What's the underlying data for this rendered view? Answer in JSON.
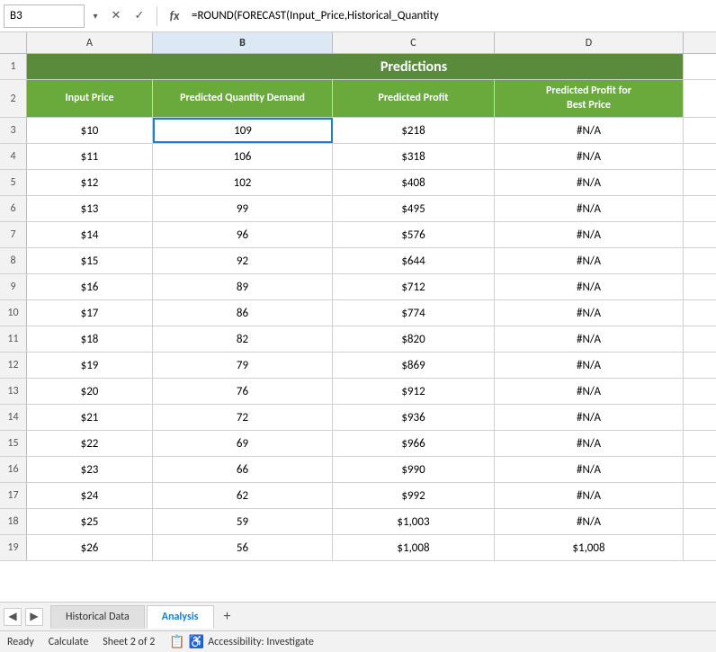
{
  "formula_bar": {
    "cell_ref": "B3",
    "formula": "=ROUND(FORECAST(Input_Price,Historical_Quantity",
    "x_label": "✕",
    "check_label": "✓",
    "fx_label": "fx"
  },
  "columns": {
    "headers": [
      "A",
      "B",
      "C",
      "D"
    ],
    "labels": {
      "a": "Input Price",
      "b": "Predicted Quantity Demand",
      "c": "Predicted Profit",
      "d": "Predicted Profit for Best Price"
    }
  },
  "title": "Predictions",
  "rows": [
    {
      "row": 3,
      "a": "$10",
      "b": "109",
      "c": "$218",
      "d": "#N/A"
    },
    {
      "row": 4,
      "a": "$11",
      "b": "106",
      "c": "$318",
      "d": "#N/A"
    },
    {
      "row": 5,
      "a": "$12",
      "b": "102",
      "c": "$408",
      "d": "#N/A"
    },
    {
      "row": 6,
      "a": "$13",
      "b": "99",
      "c": "$495",
      "d": "#N/A"
    },
    {
      "row": 7,
      "a": "$14",
      "b": "96",
      "c": "$576",
      "d": "#N/A"
    },
    {
      "row": 8,
      "a": "$15",
      "b": "92",
      "c": "$644",
      "d": "#N/A"
    },
    {
      "row": 9,
      "a": "$16",
      "b": "89",
      "c": "$712",
      "d": "#N/A"
    },
    {
      "row": 10,
      "a": "$17",
      "b": "86",
      "c": "$774",
      "d": "#N/A"
    },
    {
      "row": 11,
      "a": "$18",
      "b": "82",
      "c": "$820",
      "d": "#N/A"
    },
    {
      "row": 12,
      "a": "$19",
      "b": "79",
      "c": "$869",
      "d": "#N/A"
    },
    {
      "row": 13,
      "a": "$20",
      "b": "76",
      "c": "$912",
      "d": "#N/A"
    },
    {
      "row": 14,
      "a": "$21",
      "b": "72",
      "c": "$936",
      "d": "#N/A"
    },
    {
      "row": 15,
      "a": "$22",
      "b": "69",
      "c": "$966",
      "d": "#N/A"
    },
    {
      "row": 16,
      "a": "$23",
      "b": "66",
      "c": "$990",
      "d": "#N/A"
    },
    {
      "row": 17,
      "a": "$24",
      "b": "62",
      "c": "$992",
      "d": "#N/A"
    },
    {
      "row": 18,
      "a": "$25",
      "b": "59",
      "c": "$1,003",
      "d": "#N/A"
    },
    {
      "row": 19,
      "a": "$26",
      "b": "56",
      "c": "$1,008",
      "d": "$1,008"
    }
  ],
  "tabs": {
    "historical": "Historical Data",
    "analysis": "Analysis",
    "add": "+"
  },
  "status": {
    "ready": "Ready",
    "calculate": "Calculate",
    "sheet_info": "Sheet 2 of 2",
    "accessibility": "Accessibility: Investigate"
  }
}
